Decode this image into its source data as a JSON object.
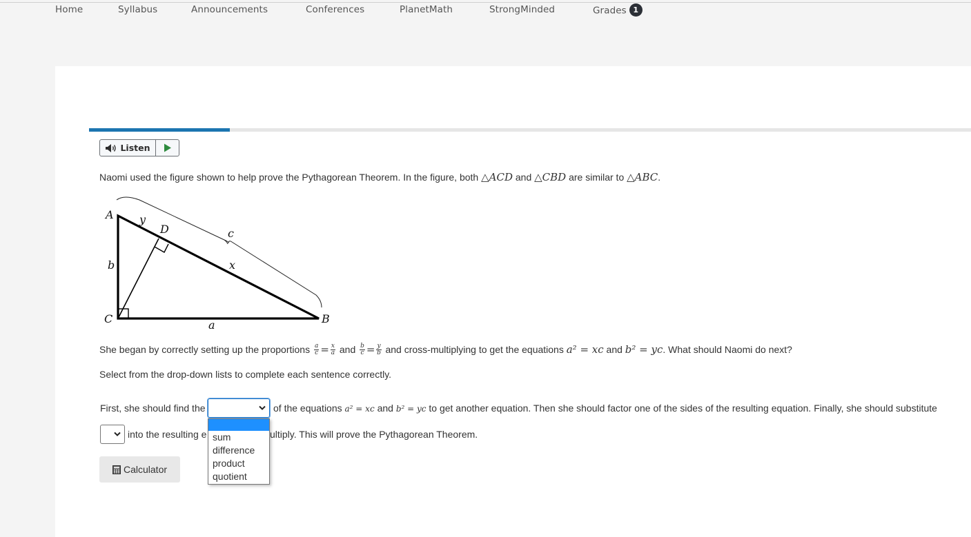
{
  "nav": {
    "items": [
      {
        "label": "Home"
      },
      {
        "label": "Syllabus"
      },
      {
        "label": "Announcements"
      },
      {
        "label": "Conferences"
      },
      {
        "label": "PlanetMath"
      },
      {
        "label": "StrongMinded"
      },
      {
        "label": "Grades",
        "badge": "1"
      }
    ]
  },
  "progress": {
    "value_percent": 16,
    "color": "#1c75b0"
  },
  "listen": {
    "label": "Listen",
    "play_color": "#2e8b3e"
  },
  "question": {
    "intro_text": "Naomi used the figure shown to help prove the Pythagorean Theorem. In the figure, both",
    "tri1": "ACD",
    "and": "and",
    "tri2": "CBD",
    "similar_text": "are similar to",
    "tri3": "ABC",
    "period": ".",
    "figure": {
      "vertices": {
        "A": "A",
        "B": "B",
        "C": "C",
        "D": "D"
      },
      "segments": {
        "a": "a",
        "b": "b",
        "c": "c",
        "x": "x",
        "y": "y"
      }
    },
    "setup": {
      "p1": "She began by correctly setting up the proportions",
      "frac1_num": "a",
      "frac1_den": "c",
      "frac2_num": "x",
      "frac2_den": "a",
      "and1": "and",
      "frac3_num": "b",
      "frac3_den": "c",
      "frac4_num": "y",
      "frac4_den": "b",
      "p2": "and cross-multiplying to get the equations",
      "eq1": "a² = xc",
      "and2": "and",
      "eq2": "b² = yc",
      "p3": ". What should Naomi do next?"
    },
    "instructions": "Select from the drop-down lists to complete each sentence correctly.",
    "sentence1_a": "First, she should find the",
    "sentence1_b": "of the equations",
    "sentence1_eq1": "a² = xc",
    "sentence1_and": "and",
    "sentence1_eq2": "b² = yc",
    "sentence1_c": "to get another equation. Then she should factor one of the sides of the resulting equation. Finally, she should substitute",
    "sentence2_a": "into the resulting e",
    "sentence2_b": "ultiply. This will prove the Pythagorean Theorem.",
    "dropdown1": {
      "selected": "",
      "options": [
        "",
        "sum",
        "difference",
        "product",
        "quotient"
      ]
    },
    "dropdown2": {
      "selected": ""
    }
  },
  "calculator": {
    "label": "Calculator"
  }
}
